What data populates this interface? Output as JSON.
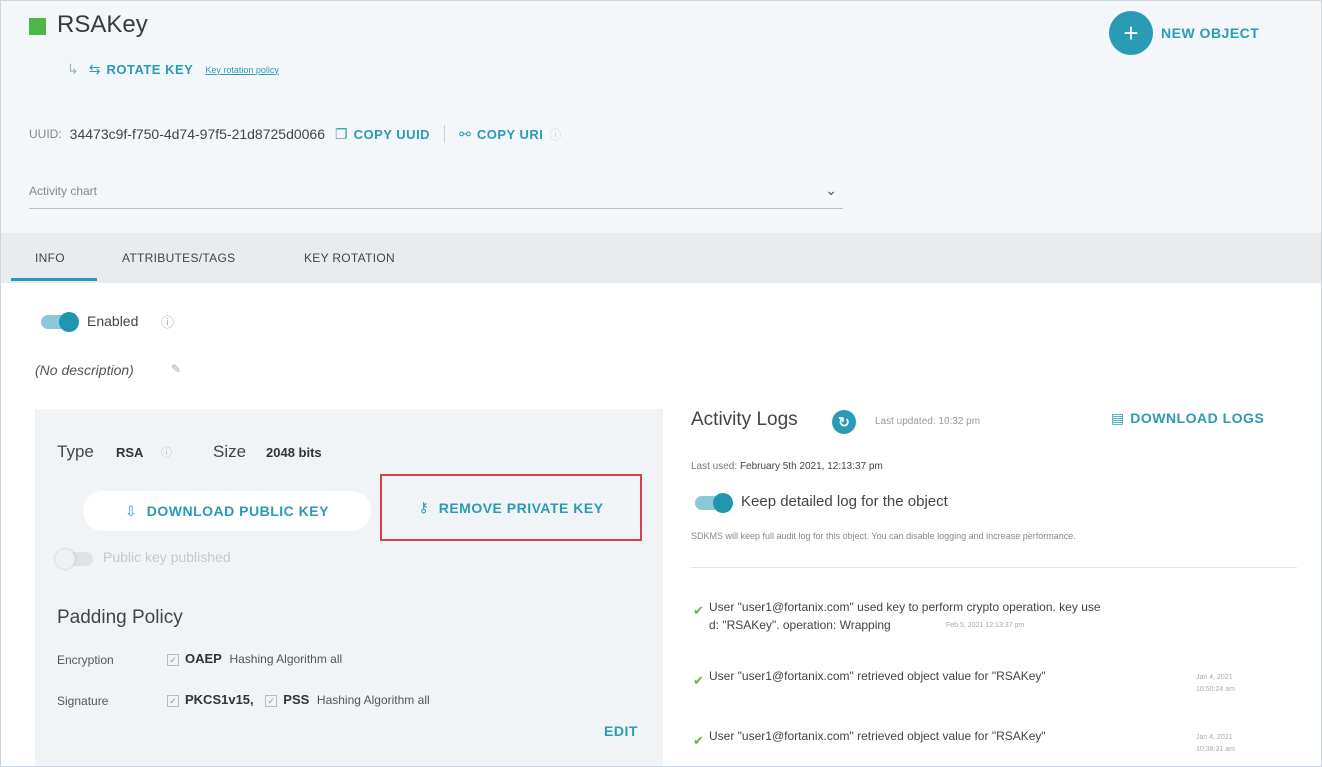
{
  "object": {
    "name": "RSAKey",
    "rotate_key_label": "ROTATE KEY",
    "rotation_policy_link": "Key rotation policy",
    "new_object_label": "NEW OBJECT"
  },
  "uuid": {
    "label": "UUID:",
    "value": "34473c9f-f750-4d74-97f5-21d8725d0066",
    "copy_uuid_label": "COPY UUID",
    "copy_uri_label": "COPY URI"
  },
  "activity_chart": {
    "label": "Activity chart"
  },
  "tabs": [
    {
      "label": "INFO",
      "active": true
    },
    {
      "label": "ATTRIBUTES/TAGS",
      "active": false
    },
    {
      "label": "KEY ROTATION",
      "active": false
    }
  ],
  "info": {
    "enabled_label": "Enabled",
    "description": "(No description)",
    "type_label": "Type",
    "type_value": "RSA",
    "size_label": "Size",
    "size_value": "2048 bits",
    "download_public_key": "DOWNLOAD PUBLIC KEY",
    "remove_private_key": "REMOVE PRIVATE KEY",
    "public_key_published": "Public key published",
    "padding_title": "Padding Policy",
    "encryption_label": "Encryption",
    "encryption_oaep": "OAEP",
    "encryption_hash": "Hashing Algorithm all",
    "signature_label": "Signature",
    "signature_pkcs": "PKCS1v15,",
    "signature_pss": "PSS",
    "signature_hash": "Hashing Algorithm all",
    "edit_label": "EDIT"
  },
  "activity_logs": {
    "title": "Activity Logs",
    "last_updated": "Last updated: 10:32 pm",
    "download_label": "DOWNLOAD LOGS",
    "last_used": "Last used:",
    "last_used_value": "February 5th 2021, 12:13:37 pm",
    "keep_detailed_label": "Keep detailed log for the object",
    "note": "SDKMS will keep full audit log for this object. You can disable logging and increase performance.",
    "entries": [
      {
        "line1": "User \"user1@fortanix.com\" used key to perform crypto operation. key use",
        "line2": "d: \"RSAKey\". operation: Wrapping",
        "time": "Feb 5, 2021 12:13:37 pm"
      },
      {
        "line1": "User \"user1@fortanix.com\" retrieved object value for \"RSAKey\"",
        "line2": "",
        "time": "Jan 4, 2021 10:50:24 am"
      },
      {
        "line1": "User \"user1@fortanix.com\" retrieved object value for \"RSAKey\"",
        "line2": "",
        "time": "Jan 4, 2021 10:38:31 am"
      }
    ]
  },
  "colors": {
    "accent": "#2a9bb5",
    "highlight_border": "#d4404c",
    "enabled_green": "#4cb748"
  }
}
